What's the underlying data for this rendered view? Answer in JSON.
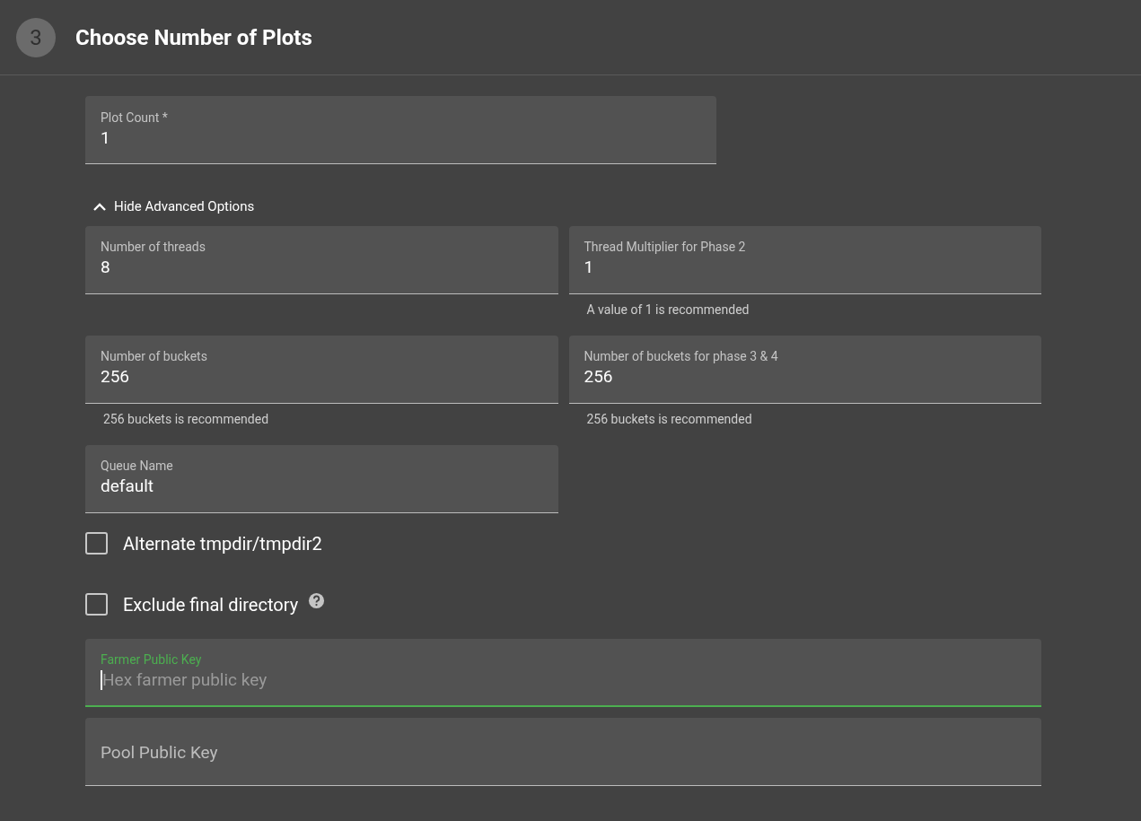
{
  "step": {
    "number": "3",
    "title": "Choose Number of Plots"
  },
  "plot_count": {
    "label": "Plot Count *",
    "value": "1"
  },
  "advanced_toggle": {
    "label": "Hide Advanced Options",
    "expanded": true
  },
  "advanced_fields": [
    {
      "label": "Number of threads",
      "value": "8"
    },
    {
      "label": "Thread Multiplier for Phase 2",
      "value": "1",
      "helper": "A value of 1 is recommended"
    },
    {
      "label": "Number of buckets",
      "value": "256",
      "helper": "256 buckets is recommended"
    },
    {
      "label": "Number of buckets for phase 3 & 4",
      "value": "256",
      "helper": "256 buckets is recommended"
    },
    {
      "label": "Queue Name",
      "value": "default"
    }
  ],
  "checkboxes": [
    {
      "label": "Alternate tmpdir/tmpdir2",
      "checked": false,
      "help": false
    },
    {
      "label": "Exclude final directory",
      "checked": false,
      "help": true
    }
  ],
  "keys": [
    {
      "label": "Farmer Public Key",
      "placeholder": "Hex farmer public key",
      "focused": true
    },
    {
      "label": "Pool Public Key",
      "focused": false
    }
  ]
}
